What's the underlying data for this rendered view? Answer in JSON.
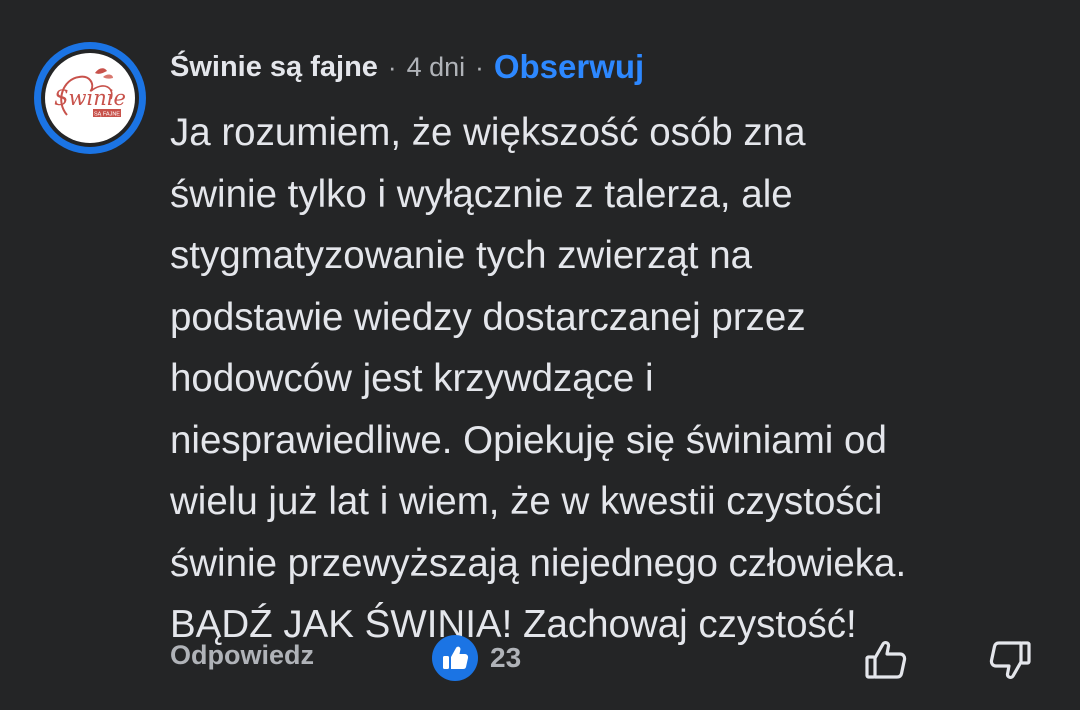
{
  "comment": {
    "author": "Świnie są fajne",
    "separator": "·",
    "time": "4 dni",
    "follow_label": "Obserwuj",
    "avatar_logo": {
      "script_text": "Świnie",
      "ribbon_text": "SĄ FAJNE",
      "colors": {
        "ring": "#1b74e4",
        "script": "#c8524b",
        "ribbon": "#c8524b"
      }
    },
    "text_lines": [
      "Ja rozumiem, że większość osób zna",
      "świnie tylko i wyłącznie z talerza, ale",
      "stygmatyzowanie tych zwierząt na",
      "podstawie wiedzy dostarczanej przez",
      "hodowców jest krzywdzące i",
      "niesprawiedliwe. Opiekuję się świniami od",
      "wielu już lat i wiem, że w kwestii czystości",
      "świnie przewyższają niejednego człowieka.",
      "BĄDŹ JAK ŚWINIA! Zachowaj czystość!"
    ]
  },
  "actions": {
    "reply_label": "Odpowiedz",
    "like_count": "23",
    "like_icon": "thumbs-up-icon",
    "upvote_icon": "thumbs-up-outline-icon",
    "downvote_icon": "thumbs-down-outline-icon"
  },
  "colors": {
    "background": "#242526",
    "primary_text": "#e4e6eb",
    "secondary_text": "#b0b3b8",
    "accent": "#2d88ff"
  }
}
